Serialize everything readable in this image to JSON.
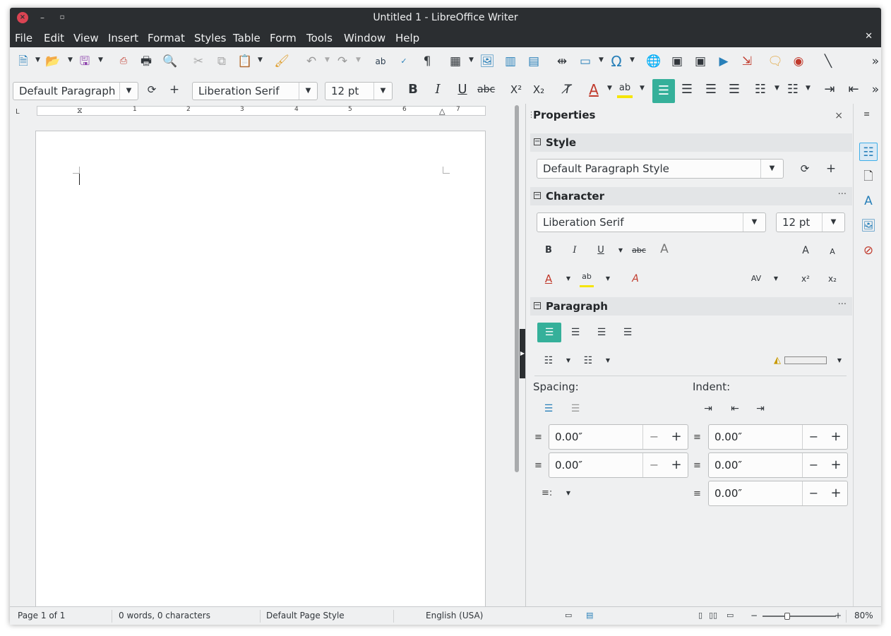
{
  "window": {
    "title": "Untitled 1 - LibreOffice Writer",
    "close_glyph": "×",
    "min_glyph": "–",
    "max_glyph": "▫"
  },
  "menubar": {
    "items": [
      "File",
      "Edit",
      "View",
      "Insert",
      "Format",
      "Styles",
      "Table",
      "Form",
      "Tools",
      "Window",
      "Help"
    ],
    "close_doc_glyph": "✕"
  },
  "standard_toolbar": {
    "icons": [
      "new-document-icon",
      "open-icon",
      "save-icon",
      "export-pdf-icon",
      "print-icon",
      "print-preview-icon",
      "cut-icon",
      "copy-icon",
      "paste-icon",
      "clone-formatting-icon",
      "undo-icon",
      "redo-icon",
      "find-replace-icon",
      "spelling-icon",
      "formatting-marks-icon",
      "insert-table-icon",
      "insert-image-icon",
      "insert-chart-icon",
      "insert-textbox-icon",
      "page-break-icon",
      "insert-field-icon",
      "special-character-icon",
      "hyperlink-icon",
      "footnote-icon",
      "endnote-icon",
      "bookmark-icon",
      "cross-reference-icon",
      "comment-icon",
      "track-changes-icon",
      "line-icon"
    ],
    "overflow_glyph": "»"
  },
  "formatting_toolbar": {
    "paragraph_style": "Default Paragraph",
    "font_name": "Liberation Serif",
    "font_size": "12 pt",
    "bold": "B",
    "italic": "I",
    "underline": "U",
    "strikethrough": "abc",
    "superscript": "X²",
    "subscript": "X₂",
    "overflow_glyph": "»"
  },
  "ruler": {
    "numbers": [
      "1",
      "2",
      "3",
      "4",
      "5",
      "6",
      "7"
    ],
    "corner": "L"
  },
  "sidebar": {
    "title": "Properties",
    "close_glyph": "×",
    "style_panel": {
      "title": "Style",
      "paragraph_style": "Default Paragraph Style"
    },
    "character_panel": {
      "title": "Character",
      "font_name": "Liberation Serif",
      "font_size": "12 pt",
      "bold": "B",
      "italic": "I",
      "underline": "U",
      "strikethrough": "abc",
      "superscript": "x²",
      "subscript": "x₂",
      "grow": "A",
      "shrink": "A",
      "more": "···"
    },
    "paragraph_panel": {
      "title": "Paragraph",
      "more": "···",
      "spacing_label": "Spacing:",
      "indent_label": "Indent:",
      "above_spacing": "0.00″",
      "below_spacing": "0.00″",
      "before_indent": "0.00″",
      "after_indent": "0.00″",
      "first_line_indent": "0.00″",
      "minus": "−",
      "plus": "+"
    }
  },
  "deck_icons": [
    "properties-icon",
    "page-icon",
    "styles-icon",
    "gallery-icon",
    "navigator-icon"
  ],
  "statusbar": {
    "page": "Page 1 of 1",
    "word_count": "0 words, 0 characters",
    "page_style": "Default Page Style",
    "language": "English (USA)",
    "zoom": "80%",
    "zoom_minus": "−",
    "zoom_plus": "+"
  },
  "colors": {
    "titlebar": "#2b2e31",
    "active_align": "#35b09a",
    "font_color": "#c0392b",
    "highlight": "#f5e50a"
  }
}
